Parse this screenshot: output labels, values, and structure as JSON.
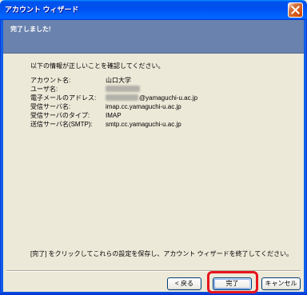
{
  "window": {
    "title": "アカウント ウィザード",
    "close_icon": "close-icon"
  },
  "header": {
    "title": "完了しました!"
  },
  "body": {
    "intro": "以下の情報が正しいことを確認してください。",
    "fields": [
      {
        "label": "アカウント名:",
        "value": "山口大学"
      },
      {
        "label": "ユーザ名:"
      },
      {
        "label": "電子メールのアドレス:",
        "value": "@yamaguchi-u.ac.jp"
      },
      {
        "label": "受信サーバ名:",
        "value": "imap.cc.yamaguchi-u.ac.jp"
      },
      {
        "label": "受信サーバのタイプ:",
        "value": "IMAP"
      },
      {
        "label": "送信サーバ名(SMTP):",
        "value": "smtp.cc.yamaguchi-u.ac.jp"
      }
    ],
    "instruction": "[完了] をクリックしてこれらの設定を保存し、アカウント ウィザードを終了してください。"
  },
  "buttons": {
    "back": "< 戻る",
    "finish": "完了",
    "cancel": "キャンセル"
  },
  "colors": {
    "title_bar": "#0053EE",
    "header_band": "#6A82AE",
    "dialog_background": "#ECE9D8",
    "annotation_highlight": "#E8141E"
  }
}
